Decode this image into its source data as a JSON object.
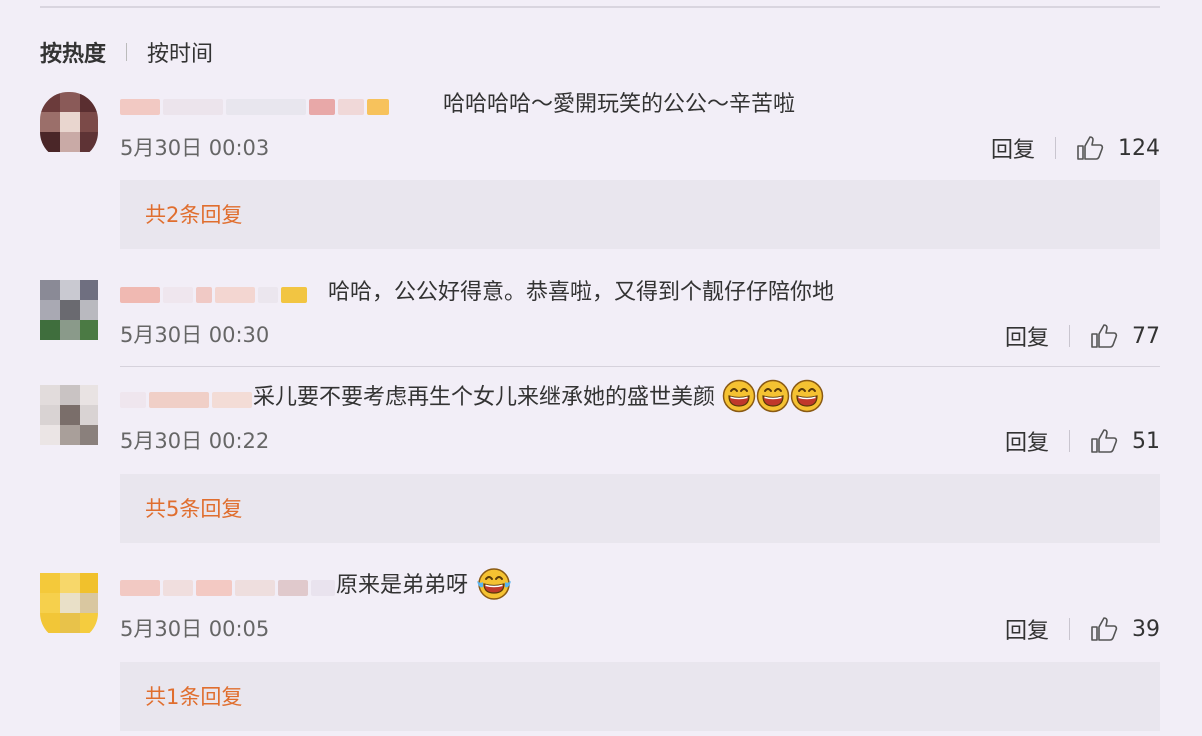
{
  "sort_tabs": [
    {
      "label": "按热度",
      "active": true
    },
    {
      "label": "按时间",
      "active": false
    }
  ],
  "comments": [
    {
      "text": "哈哈哈哈～愛開玩笑的公公～辛苦啦",
      "time": "5月30日 00:03",
      "reply_label": "回复",
      "likes": "124",
      "reply_count": "共2条回复"
    },
    {
      "text": "哈哈，公公好得意。恭喜啦，又得到个靓仔仔陪你地",
      "time": "5月30日 00:30",
      "reply_label": "回复",
      "likes": "77"
    },
    {
      "text": "采儿要不要考虑再生个女儿来继承她的盛世美颜",
      "time": "5月30日 00:22",
      "reply_label": "回复",
      "likes": "51",
      "reply_count": "共5条回复"
    },
    {
      "text": "原来是弟弟呀",
      "time": "5月30日 00:05",
      "reply_label": "回复",
      "likes": "39",
      "reply_count": "共1条回复"
    }
  ],
  "icons": {
    "like": "thumbs-up-icon",
    "emoji": "laughing-emoji-icon",
    "emoji_tears": "tears-of-joy-emoji-icon"
  },
  "colors": {
    "background": "#f2eef7",
    "reply_box": "#e9e6ee",
    "reply_link": "#e06e2e",
    "text": "#333333",
    "muted": "#666666"
  }
}
